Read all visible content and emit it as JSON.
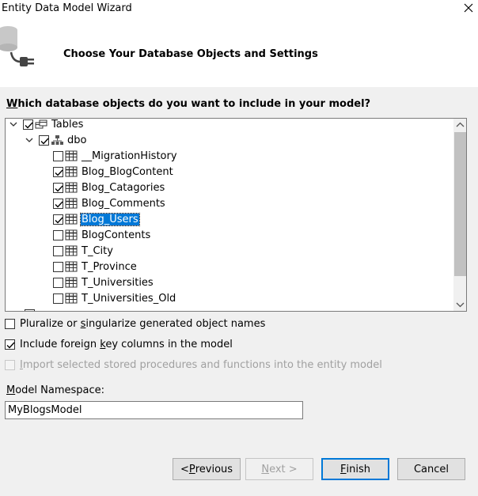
{
  "window": {
    "title": "Entity Data Model Wizard",
    "close_glyph": "✕"
  },
  "header": {
    "title": "Choose Your Database Objects and Settings",
    "icon": "database-connect-icon"
  },
  "question": {
    "hotkey": "W",
    "rest": "hich database objects do you want to include in your model?"
  },
  "tree": {
    "root": {
      "label": "Tables",
      "checked": true,
      "expanded": true
    },
    "schema": {
      "label": "dbo",
      "checked": true,
      "expanded": true
    },
    "items": [
      {
        "label": "__MigrationHistory",
        "checked": false,
        "selected": false
      },
      {
        "label": "Blog_BlogContent",
        "checked": true,
        "selected": false
      },
      {
        "label": "Blog_Catagories",
        "checked": true,
        "selected": false
      },
      {
        "label": "Blog_Comments",
        "checked": true,
        "selected": false
      },
      {
        "label": "Blog_Users",
        "checked": true,
        "selected": true
      },
      {
        "label": "BlogContents",
        "checked": false,
        "selected": false
      },
      {
        "label": "T_City",
        "checked": false,
        "selected": false
      },
      {
        "label": "T_Province",
        "checked": false,
        "selected": false
      },
      {
        "label": "T_Universities",
        "checked": false,
        "selected": false
      },
      {
        "label": "T_Universities_Old",
        "checked": false,
        "selected": false
      }
    ]
  },
  "options": {
    "pluralize": {
      "pre": "Pluralize or ",
      "hotkey": "s",
      "post": "ingularize generated object names",
      "checked": false,
      "enabled": true
    },
    "foreign_keys": {
      "pre": "Include foreign ",
      "hotkey": "k",
      "post": "ey columns in the model",
      "checked": true,
      "enabled": true
    },
    "stored_procs": {
      "pre": "",
      "hotkey": "I",
      "post": "mport selected stored procedures and functions into the entity model",
      "checked": false,
      "enabled": false
    }
  },
  "namespace": {
    "label_hotkey": "M",
    "label_rest": "odel Namespace:",
    "value": "MyBlogsModel"
  },
  "buttons": {
    "previous": {
      "pre": "< ",
      "hotkey": "P",
      "post": "revious",
      "enabled": true
    },
    "next": {
      "pre": "",
      "hotkey": "N",
      "post": "ext >",
      "enabled": false
    },
    "finish": {
      "pre": "",
      "hotkey": "F",
      "post": "inish",
      "enabled": true
    },
    "cancel": {
      "label": "Cancel",
      "enabled": true
    }
  },
  "colors": {
    "selection": "#0078d7",
    "dialog_bg": "#f0f0f0",
    "header_bg": "#ffffff"
  }
}
